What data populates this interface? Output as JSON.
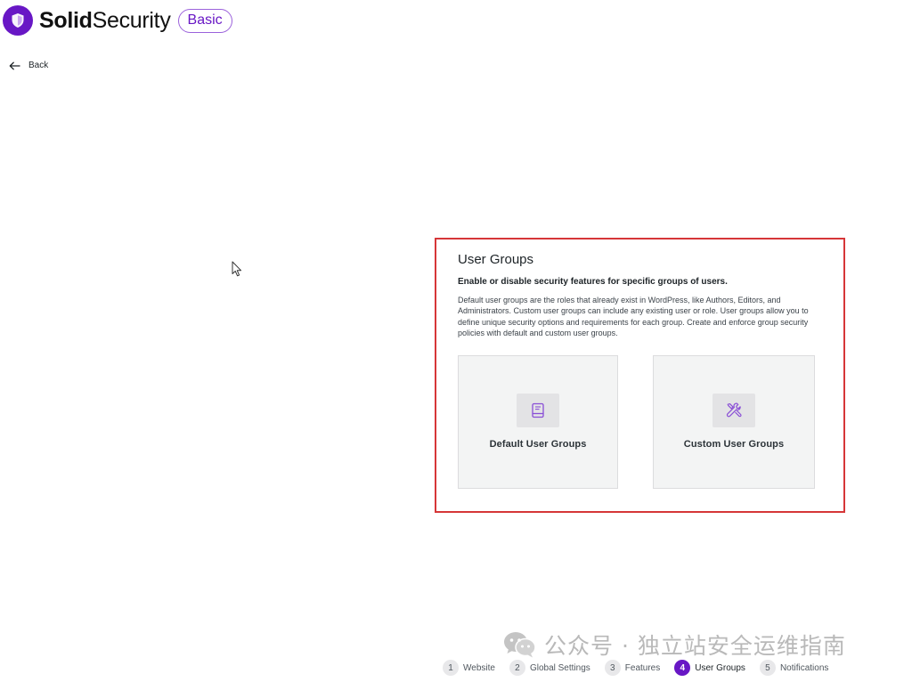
{
  "brand": {
    "name_bold": "Solid",
    "name_light": "Security",
    "plan_badge": "Basic",
    "accent_color": "#6817c5",
    "logo_icon": "shield-icon"
  },
  "nav": {
    "back_label": "Back",
    "back_icon": "arrow-left-icon"
  },
  "panel": {
    "title": "User Groups",
    "subtitle": "Enable or disable security features for specific groups of users.",
    "description": "Default user groups are the roles that already exist in WordPress, like Authors, Editors, and Administrators. Custom user groups can include any existing user or role. User groups allow you to define unique security options and requirements for each group. Create and enforce group security policies with default and custom user groups.",
    "highlight_color": "#d63638",
    "options": [
      {
        "label": "Default User Groups",
        "icon": "book-icon"
      },
      {
        "label": "Custom User Groups",
        "icon": "tools-icon"
      }
    ]
  },
  "watermark": {
    "text": "公众号 · 独立站安全运维指南",
    "icon": "wechat-icon"
  },
  "stepper": {
    "steps": [
      {
        "number": "1",
        "label": "Website"
      },
      {
        "number": "2",
        "label": "Global Settings"
      },
      {
        "number": "3",
        "label": "Features"
      },
      {
        "number": "4",
        "label": "User Groups"
      },
      {
        "number": "5",
        "label": "Notifications"
      }
    ],
    "active_step": "4"
  }
}
